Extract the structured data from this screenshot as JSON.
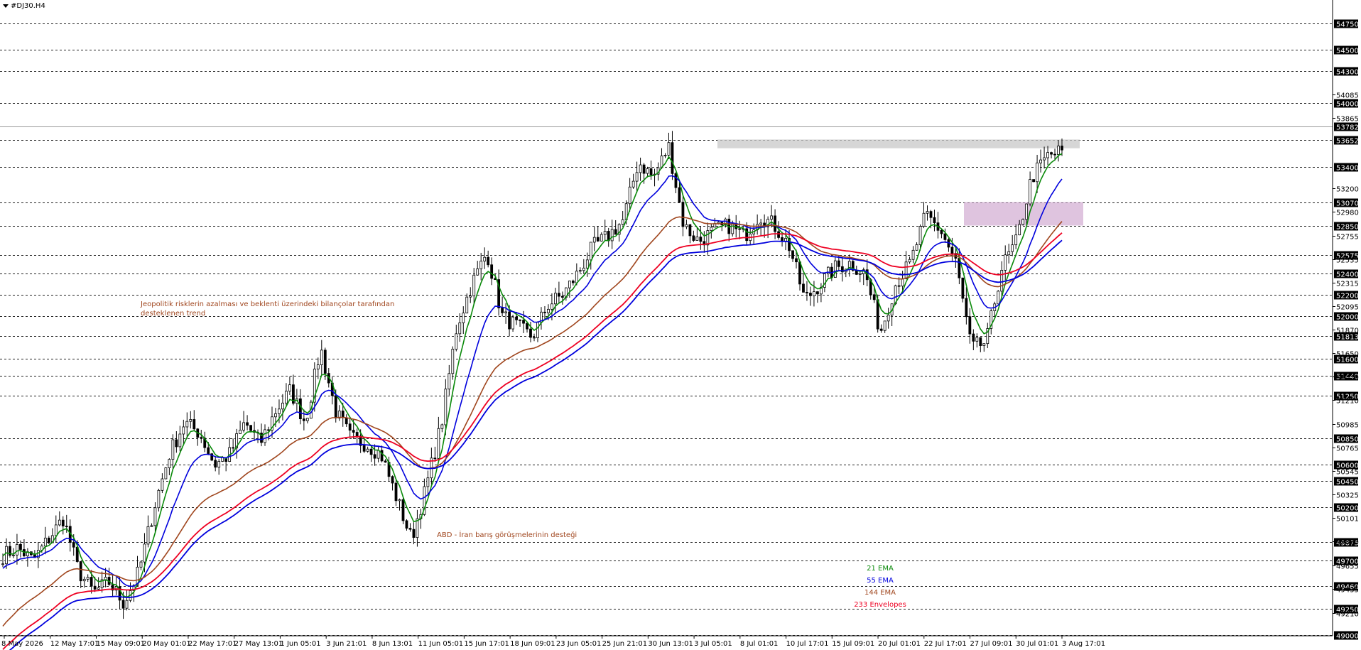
{
  "header": {
    "symbol": "#DJ30.H4",
    "menu_icon": "triangle-down-icon"
  },
  "colors": {
    "ema21": "#0a8a0a",
    "ema55": "#0000dd",
    "ema144": "#a0461e",
    "env_upper": "#ee0022",
    "env_lower": "#0000dd",
    "annotation": "#a0461e",
    "resistance_zone": "#c8c8c8",
    "support_zone": "#c99cc9",
    "grid": "#222222",
    "price_label_bg": "#000000"
  },
  "chart_data": {
    "type": "candlestick",
    "title": "#DJ30.H4",
    "ylim": [
      49000,
      55000
    ],
    "price_levels": [
      54750,
      54500,
      54300,
      54000,
      53652,
      53400,
      53070,
      52850,
      52575,
      52400,
      52200,
      52000,
      51813,
      51600,
      51440,
      51250,
      50850,
      50600,
      50450,
      50200,
      49875,
      49700,
      49460,
      49250,
      49000
    ],
    "axis_ticks": [
      54085,
      53865,
      53200,
      52980,
      52755,
      52535,
      52315,
      52095,
      51870,
      51650,
      51430,
      51210,
      50985,
      50765,
      50545,
      50325,
      50101,
      49880,
      49655,
      49435,
      49210
    ],
    "current_price": 53782,
    "x_labels": [
      "8 May 2026",
      "12 May 17:01",
      "15 May 09:01",
      "20 May 01:01",
      "22 May 17:01",
      "27 May 13:01",
      "1 Jun 05:01",
      "3 Jun 21:01",
      "8 Jun 13:01",
      "11 Jun 05:01",
      "15 Jun 17:01",
      "18 Jun 09:01",
      "23 Jun 05:01",
      "25 Jun 21:01",
      "30 Jun 13:01",
      "3 Jul 05:01",
      "8 Jul 01:01",
      "10 Jul 17:01",
      "15 Jul 09:01",
      "20 Jul 01:01",
      "22 Jul 17:01",
      "27 Jul 09:01",
      "30 Jul 01:01",
      "3 Aug 17:01"
    ],
    "close_path": [
      49750,
      49820,
      49700,
      49900,
      50100,
      49600,
      49400,
      49500,
      49300,
      49600,
      50200,
      50700,
      51000,
      50900,
      50600,
      50700,
      51000,
      50800,
      51100,
      51300,
      51000,
      51700,
      51100,
      50850,
      50800,
      50700,
      50300,
      49900,
      50400,
      51000,
      51900,
      52300,
      52600,
      52000,
      51900,
      51800,
      52100,
      52200,
      52400,
      52650,
      52750,
      52900,
      53450,
      53300,
      53600,
      52850,
      52700,
      52800,
      52850,
      52750,
      52950,
      52850,
      52650,
      52150,
      52300,
      52450,
      52500,
      52400,
      51850,
      52300,
      52500,
      52950,
      52800,
      52500,
      51700,
      51750,
      52450,
      52700,
      53300,
      53500,
      53550
    ],
    "resistance_zone": {
      "from_price": 53652,
      "to_price": 53610
    },
    "support_zone": {
      "from_price": 53070,
      "to_price": 52850
    },
    "annotations": [
      "Jeopolitik risklerin azalması ve beklenti üzerindeki bilançolar tarafından desteklenen trend",
      "ABD - İran barış görüşmelerinin desteği"
    ],
    "legend": [
      "21 EMA",
      "55 EMA",
      "144 EMA",
      "233 Envelopes"
    ],
    "legend_position": "bottom-center",
    "grid": "horizontal dashed at price levels"
  }
}
